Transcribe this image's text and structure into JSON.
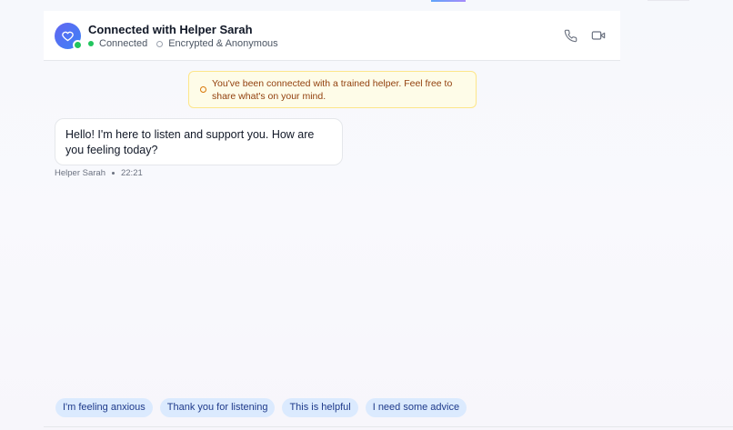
{
  "header": {
    "title": "Connected with Helper Sarah",
    "status": "Connected",
    "security": "Encrypted & Anonymous",
    "icons": {
      "avatar": "heart-icon",
      "call": "phone-icon",
      "video": "video-icon"
    }
  },
  "notice": {
    "text": "You've been connected with a trained helper. Feel free to share what's on your mind."
  },
  "messages": [
    {
      "sender": "Helper Sarah",
      "text": "Hello! I'm here to listen and support you. How are you feeling today?",
      "time": "22:21"
    }
  ],
  "suggestions": [
    "I'm feeling anxious",
    "Thank you for listening",
    "This is helpful",
    "I need some advice"
  ],
  "colors": {
    "online": "#22c55e",
    "avatar_gradient_start": "#6366f1",
    "avatar_gradient_end": "#3b82f6",
    "chip_bg": "#dbeafe",
    "notice_bg": "#fefce8"
  }
}
